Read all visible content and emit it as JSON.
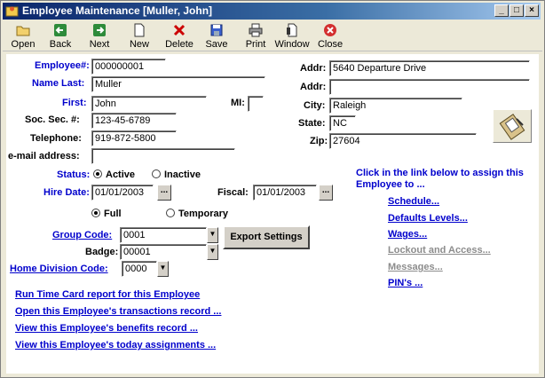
{
  "window": {
    "title": "Employee Maintenance [Muller, John]",
    "minimize": "_",
    "maximize": "□",
    "close": "×"
  },
  "toolbar": {
    "open": "Open",
    "back": "Back",
    "next": "Next",
    "new": "New",
    "delete": "Delete",
    "save": "Save",
    "print": "Print",
    "window": "Window",
    "close": "Close"
  },
  "form": {
    "employee_label": "Employee#:",
    "employee_value": "000000001",
    "name_last_label": "Name Last:",
    "name_last_value": "Muller",
    "first_label": "First:",
    "first_value": "John",
    "mi_label": "MI:",
    "mi_value": "",
    "ssn_label": "Soc. Sec. #:",
    "ssn_value": "123-45-6789",
    "telephone_label": "Telephone:",
    "telephone_value": "919-872-5800",
    "email_label": "e-mail address:",
    "email_value": "",
    "addr1_label": "Addr:",
    "addr1_value": "5640 Departure Drive",
    "addr2_label": "Addr:",
    "addr2_value": "",
    "city_label": "City:",
    "city_value": "Raleigh",
    "state_label": "State:",
    "state_value": "NC",
    "zip_label": "Zip:",
    "zip_value": "27604",
    "status_label": "Status:",
    "status_active": "Active",
    "status_inactive": "Inactive",
    "hire_date_label": "Hire Date:",
    "hire_date_value": "01/01/2003",
    "fiscal_label": "Fiscal:",
    "fiscal_value": "01/01/2003",
    "ellipsis": "...",
    "full": "Full",
    "temporary": "Temporary",
    "group_code_label": "Group Code:",
    "group_code_value": "0001",
    "badge_label": "Badge:",
    "badge_value": "00001",
    "home_division_label": "Home Division Code:",
    "home_division_value": "0000",
    "export_settings": "Export Settings"
  },
  "links": {
    "intro": "Click in the link below to assign this Employee to ...",
    "schedule": "Schedule...",
    "defaults_levels": "Defaults Levels...",
    "wages": "Wages...",
    "lockout": "Lockout and Access...",
    "messages": "Messages...",
    "pins": "PIN's ..."
  },
  "bottom_links": {
    "run_timecard": "Run  Time Card  report for this Employee",
    "transactions": "Open this Employee's transactions record ...",
    "benefits": "View this Employee's benefits record ...",
    "assignments": "View this Employee's today assignments ..."
  },
  "colors": {
    "label_blue": "#0000cc",
    "disabled_gray": "#8c8c8c",
    "title_blue": "#0a246a"
  }
}
